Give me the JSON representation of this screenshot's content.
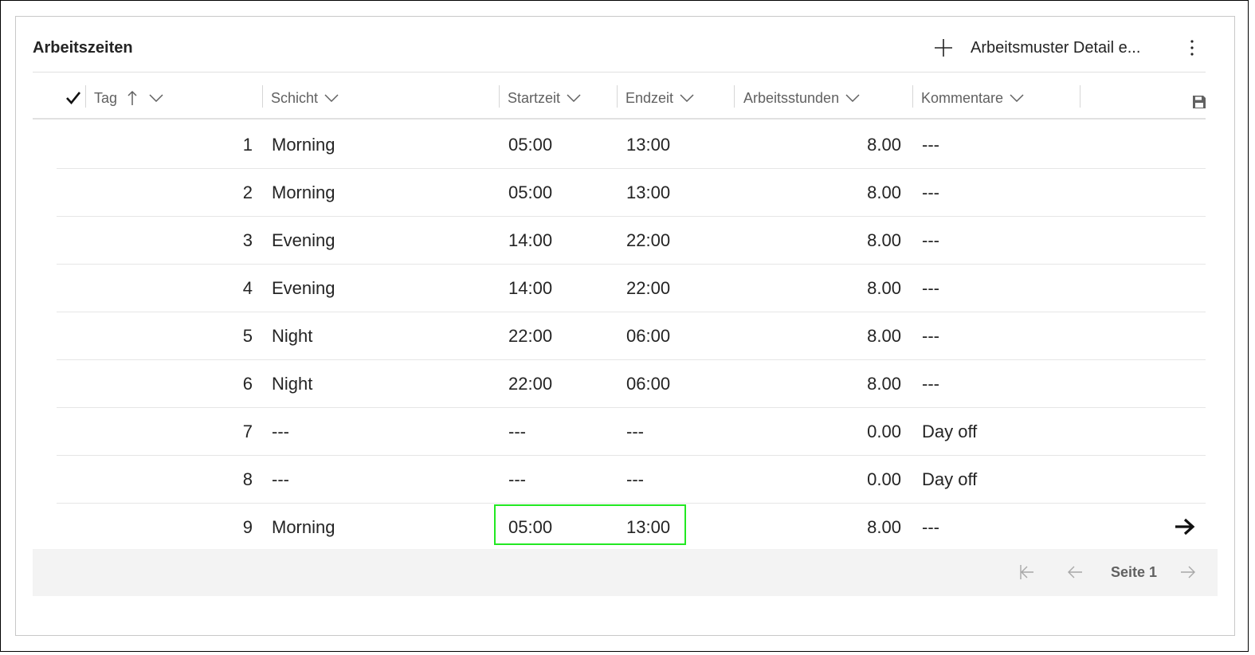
{
  "panel": {
    "title": "Arbeitszeiten",
    "add_button_label": "Arbeitsmuster Detail e...",
    "add_icon": "plus-icon",
    "more_icon": "more-vertical-icon"
  },
  "table": {
    "columns": {
      "tag": "Tag",
      "schicht": "Schicht",
      "startzeit": "Startzeit",
      "endzeit": "Endzeit",
      "arbeitsstunden": "Arbeitsstunden",
      "kommentare": "Kommentare"
    },
    "select_all_icon": "checkmark-icon",
    "sort_icon": "arrow-up-icon",
    "save_icon": "save-icon",
    "rows": [
      {
        "tag": "1",
        "schicht": "Morning",
        "start": "05:00",
        "end": "13:00",
        "stunden": "8.00",
        "kommentar": "---"
      },
      {
        "tag": "2",
        "schicht": "Morning",
        "start": "05:00",
        "end": "13:00",
        "stunden": "8.00",
        "kommentar": "---"
      },
      {
        "tag": "3",
        "schicht": "Evening",
        "start": "14:00",
        "end": "22:00",
        "stunden": "8.00",
        "kommentar": "---"
      },
      {
        "tag": "4",
        "schicht": "Evening",
        "start": "14:00",
        "end": "22:00",
        "stunden": "8.00",
        "kommentar": "---"
      },
      {
        "tag": "5",
        "schicht": "Night",
        "start": "22:00",
        "end": "06:00",
        "stunden": "8.00",
        "kommentar": "---"
      },
      {
        "tag": "6",
        "schicht": "Night",
        "start": "22:00",
        "end": "06:00",
        "stunden": "8.00",
        "kommentar": "---"
      },
      {
        "tag": "7",
        "schicht": "---",
        "start": "---",
        "end": "---",
        "stunden": "0.00",
        "kommentar": "Day off"
      },
      {
        "tag": "8",
        "schicht": "---",
        "start": "---",
        "end": "---",
        "stunden": "0.00",
        "kommentar": "Day off"
      },
      {
        "tag": "9",
        "schicht": "Morning",
        "start": "05:00",
        "end": "13:00",
        "stunden": "8.00",
        "kommentar": "---"
      }
    ]
  },
  "pagination": {
    "page_label": "Seite 1"
  },
  "colors": {
    "focus_outline": "#22e822",
    "footer_bg": "#f3f3f3"
  }
}
